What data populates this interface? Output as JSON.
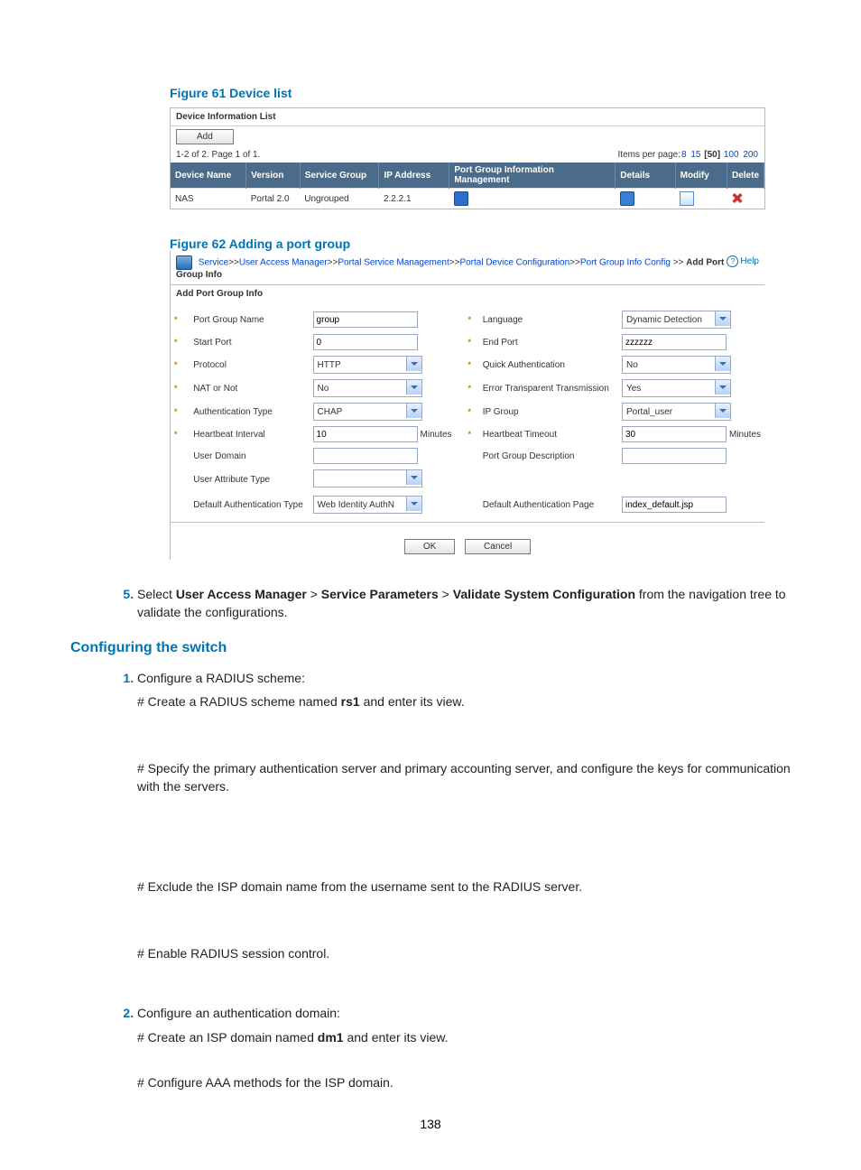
{
  "fig61": {
    "title": "Figure 61 Device list",
    "panel_title": "Device Information List",
    "add_btn": "Add",
    "pager_left": "1-2 of 2. Page 1 of 1.",
    "pager_label": "Items per page:",
    "pp_opts": [
      "8",
      "15",
      "[50]",
      "100",
      "200"
    ],
    "cols": [
      "Device Name",
      "Version",
      "Service Group",
      "IP Address",
      "Port Group Information Management",
      "Details",
      "Modify",
      "Delete"
    ],
    "row": {
      "name": "NAS",
      "ver": "Portal 2.0",
      "sg": "Ungrouped",
      "ip": "2.2.2.1"
    }
  },
  "fig62": {
    "title": "Figure 62 Adding a port group",
    "crumbs": [
      "Service",
      "User Access Manager",
      "Portal Service Management",
      "Portal Device Configuration",
      "Port Group Info Config"
    ],
    "crumb_tail": "Add Port Group Info",
    "help": "Help",
    "section": "Add Port Group Info",
    "fields": {
      "pgn_l": "Port Group Name",
      "pgn_v": "group",
      "lang_l": "Language",
      "lang_v": "Dynamic Detection",
      "sp_l": "Start Port",
      "sp_v": "0",
      "ep_l": "End Port",
      "ep_v": "zzzzzz",
      "proto_l": "Protocol",
      "proto_v": "HTTP",
      "qa_l": "Quick Authentication",
      "qa_v": "No",
      "nat_l": "NAT or Not",
      "nat_v": "No",
      "ett_l": "Error Transparent Transmission",
      "ett_v": "Yes",
      "at_l": "Authentication Type",
      "at_v": "CHAP",
      "ipg_l": "IP Group",
      "ipg_v": "Portal_user",
      "hi_l": "Heartbeat Interval",
      "hi_v": "10",
      "hi_u": "Minutes",
      "ht_l": "Heartbeat Timeout",
      "ht_v": "30",
      "ht_u": "Minutes",
      "ud_l": "User Domain",
      "ud_v": "",
      "pgd_l": "Port Group Description",
      "pgd_v": "",
      "uat_l": "User Attribute Type",
      "uat_v": "",
      "dat_l": "Default Authentication Type",
      "dat_v": "Web Identity AuthN",
      "dap_l": "Default Authentication Page",
      "dap_v": "index_default.jsp"
    },
    "ok": "OK",
    "cancel": "Cancel"
  },
  "step5": {
    "text_a": "Select ",
    "b1": "User Access Manager",
    "sep": " > ",
    "b2": "Service Parameters",
    "b3": "Validate System Configuration",
    "text_b": " from the navigation tree to validate the configurations."
  },
  "sect": "Configuring the switch",
  "s1": {
    "title": "Configure a RADIUS scheme:",
    "l1a": "# Create a RADIUS scheme named ",
    "l1b": "rs1",
    "l1c": " and enter its view.",
    "l2": "# Specify the primary authentication server and primary accounting server, and configure the keys for communication with the servers.",
    "l3": "# Exclude the ISP domain name from the username sent to the RADIUS server.",
    "l4": "# Enable RADIUS session control."
  },
  "s2": {
    "title": "Configure an authentication domain:",
    "l1a": "# Create an ISP domain named ",
    "l1b": "dm1",
    "l1c": " and enter its view.",
    "l2": "# Configure AAA methods for the ISP domain."
  },
  "page_num": "138"
}
